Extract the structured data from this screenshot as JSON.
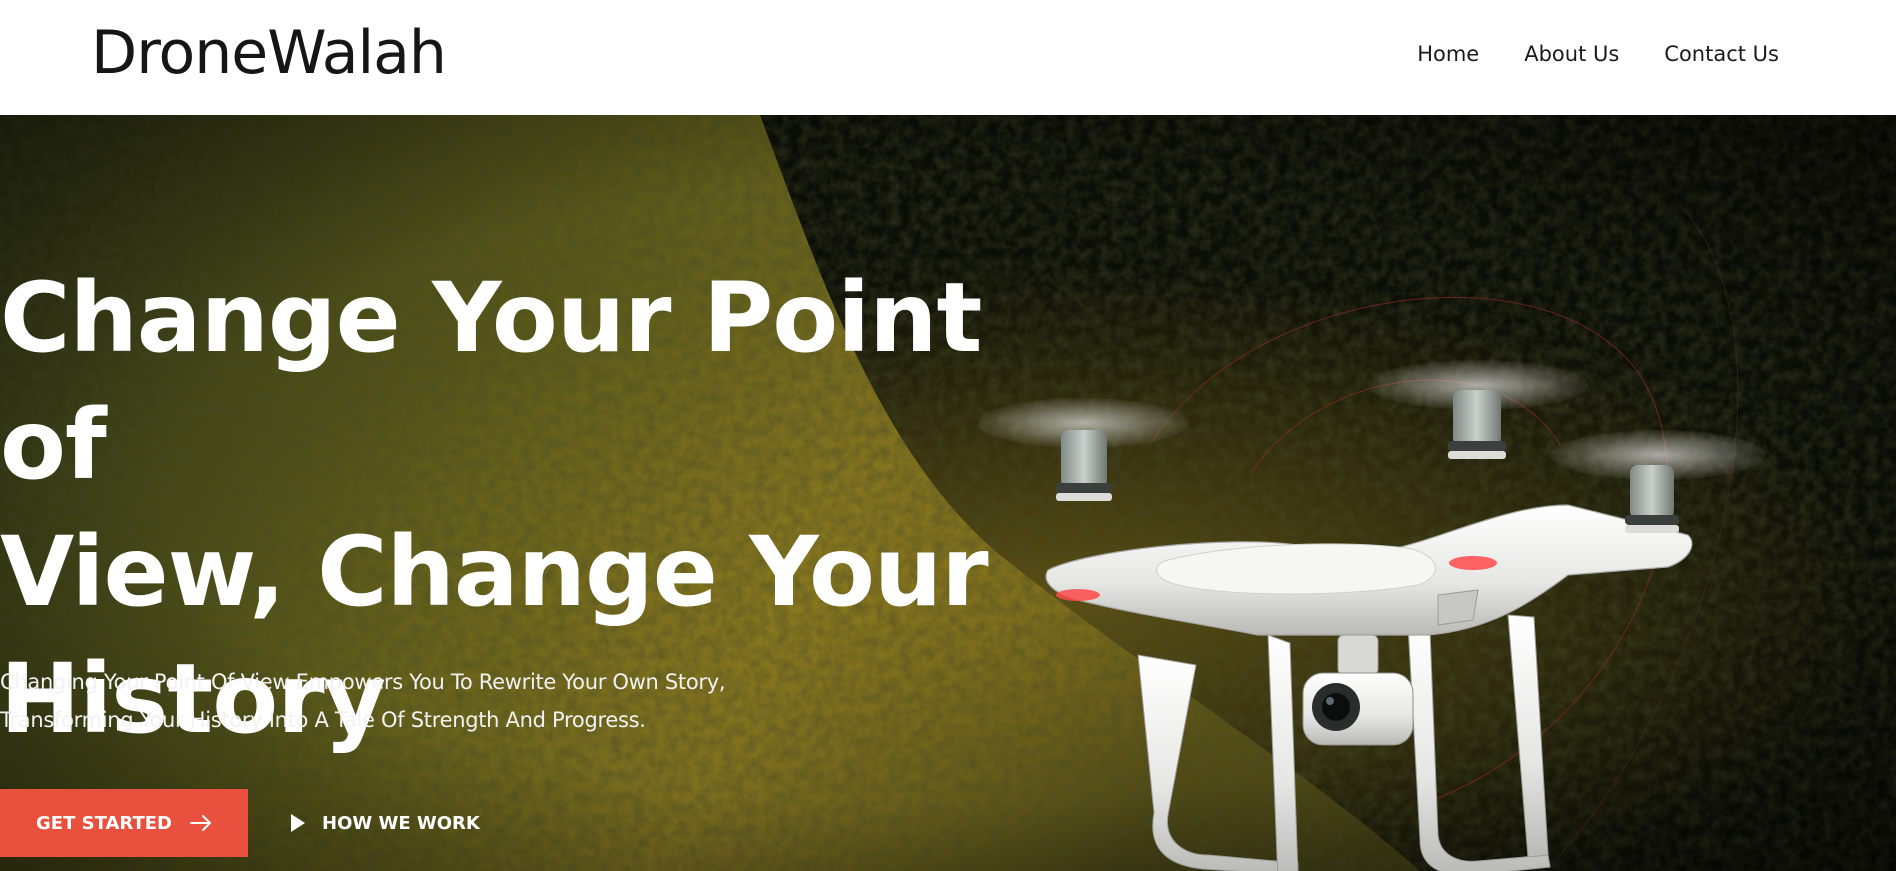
{
  "brand": {
    "logo": "DroneWalah"
  },
  "nav": {
    "items": [
      {
        "label": "Home"
      },
      {
        "label": "About Us"
      },
      {
        "label": "Contact Us"
      }
    ]
  },
  "hero": {
    "title_lines": [
      "Change Your Point of",
      "View, Change Your",
      "History"
    ],
    "subtitle_lines": [
      "Changing Your Point Of View Empowers You To Rewrite Your Own Story,",
      "Transforming Your History Into A Tale Of Strength And Progress."
    ],
    "primary_button": {
      "label": "GET STARTED",
      "icon": "arrow-right-icon"
    },
    "secondary_button": {
      "label": "HOW WE WORK",
      "icon": "play-icon"
    }
  },
  "colors": {
    "accent": "#e9503d",
    "header_bg": "#ffffff",
    "hero_text": "#ffffff",
    "forest_dark": "#0e100a",
    "forest_light": "#6b6a1a"
  }
}
